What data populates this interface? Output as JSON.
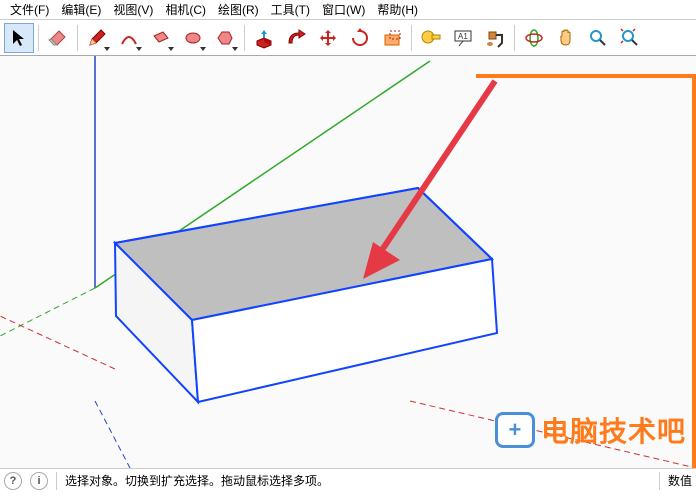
{
  "menubar": {
    "items": [
      {
        "label": "文件(F)"
      },
      {
        "label": "编辑(E)"
      },
      {
        "label": "视图(V)"
      },
      {
        "label": "相机(C)"
      },
      {
        "label": "绘图(R)"
      },
      {
        "label": "工具(T)"
      },
      {
        "label": "窗口(W)"
      },
      {
        "label": "帮助(H)"
      }
    ]
  },
  "toolbar": {
    "tools": [
      {
        "name": "select-tool",
        "icon": "arrow",
        "active": true
      },
      {
        "name": "eraser-tool",
        "icon": "eraser"
      },
      {
        "name": "line-tool",
        "icon": "pencil",
        "dropdown": true
      },
      {
        "name": "arc-tool",
        "icon": "arc",
        "dropdown": true
      },
      {
        "name": "rectangle-tool",
        "icon": "rect",
        "dropdown": true
      },
      {
        "name": "circle-tool",
        "icon": "circle",
        "dropdown": true
      },
      {
        "name": "polygon-tool",
        "icon": "polygon",
        "dropdown": true
      },
      {
        "name": "pushpull-tool",
        "icon": "pushpull"
      },
      {
        "name": "followme-tool",
        "icon": "followme"
      },
      {
        "name": "move-tool",
        "icon": "move"
      },
      {
        "name": "rotate-tool",
        "icon": "rotate"
      },
      {
        "name": "scale-tool",
        "icon": "scale"
      },
      {
        "name": "tape-tool",
        "icon": "tape"
      },
      {
        "name": "text-tool",
        "icon": "text"
      },
      {
        "name": "paint-tool",
        "icon": "paint"
      },
      {
        "name": "orbit-tool",
        "icon": "orbit"
      },
      {
        "name": "pan-tool",
        "icon": "pan"
      },
      {
        "name": "zoom-tool",
        "icon": "zoom"
      },
      {
        "name": "zoom-extents-tool",
        "icon": "zoomext"
      }
    ]
  },
  "statusbar": {
    "hint": "选择对象。切换到扩充选择。拖动鼠标选择多项。",
    "value_label": "数值"
  },
  "watermark": {
    "text": "电脑技术吧"
  },
  "colors": {
    "axis_x": "#cc3333",
    "axis_y": "#2ea82e",
    "axis_z": "#2244cc",
    "selection": "#1144ff",
    "arrow": "#e53946"
  }
}
